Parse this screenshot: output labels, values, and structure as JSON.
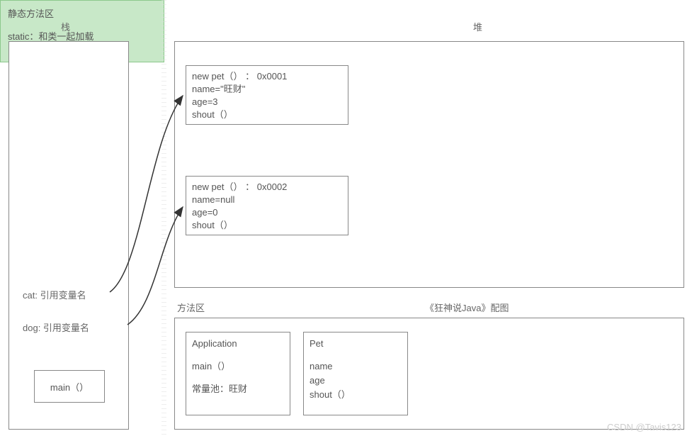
{
  "titles": {
    "stack": "栈",
    "heap": "堆",
    "method_area": "方法区",
    "book": "《狂神说Java》配图"
  },
  "stack": {
    "cat_label": "cat: 引用变量名",
    "dog_label": "dog: 引用变量名",
    "main_label": "main（）"
  },
  "heap": {
    "obj1": {
      "line1": "new pet（） ： 0x0001",
      "line2": "name=\"旺财\"",
      "line3": "age=3",
      "line4": "shout（）"
    },
    "obj2": {
      "line1": "new pet（） ： 0x0002",
      "line2": "name=null",
      "line3": "age=0",
      "line4": "shout（）"
    }
  },
  "method_area": {
    "application": {
      "title": "Application",
      "main": "main（）",
      "const_pool": "常量池：旺财"
    },
    "pet": {
      "title": "Pet",
      "field1": "name",
      "field2": "age",
      "method": "shout（）"
    },
    "static_area": {
      "title": "静态方法区",
      "desc": "static：和类一起加载"
    }
  },
  "watermark": "CSDN @Tavis123"
}
